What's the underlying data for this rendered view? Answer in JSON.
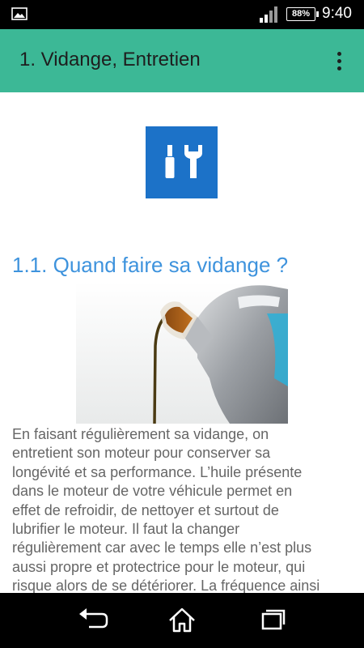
{
  "status_bar": {
    "battery": "88%",
    "time": "9:40"
  },
  "app_bar": {
    "title": "1.  Vidange, Entretien"
  },
  "content": {
    "tools_icon": "screwdriver-wrench-icon",
    "heading": "1.1. Quand faire sa vidange ?",
    "paragraph": "En faisant régulièrement sa vidange, on\nentretient son moteur pour conserver sa\nlongévité et sa performance. L’huile présente\ndans le moteur de votre véhicule permet en\neffet de refroidir, de nettoyer et surtout de\nlubrifier le moteur. Il faut la changer\nrégulièrement car avec le temps elle n’est plus\naussi propre et protectrice pour le moteur, qui\nrisque alors de se détériorer.  La fréquence ainsi"
  },
  "colors": {
    "app_bar": "#3cb896",
    "tile": "#1c72c8",
    "heading": "#3e93dd"
  }
}
